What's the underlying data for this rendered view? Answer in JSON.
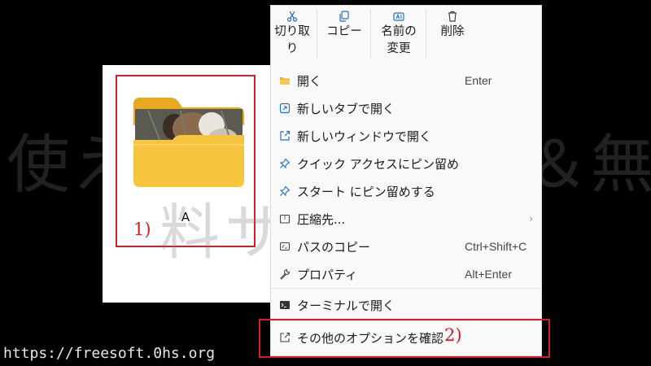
{
  "watermark": {
    "line1": "使える無料ソフト＆無",
    "line2": "料サービス"
  },
  "site_url": "https://freesoft.0hs.org",
  "explorer": {
    "folder": {
      "name": "A",
      "icon": "folder-icon-with-photo-thumbnail"
    }
  },
  "markers": {
    "one": "1)",
    "two": "2)"
  },
  "colors": {
    "highlight": "#d32027",
    "folder": "#f4c542",
    "accent": "#1f6fd1"
  },
  "context_menu": {
    "toolbar": [
      {
        "label_line1": "切り取",
        "label_line2": "り",
        "icon": "scissors-icon"
      },
      {
        "label_line1": "コピー",
        "label_line2": "",
        "icon": "copy-icon"
      },
      {
        "label_line1": "名前の",
        "label_line2": "変更",
        "icon": "rename-icon"
      },
      {
        "label_line1": "削除",
        "label_line2": "",
        "icon": "trash-icon"
      }
    ],
    "items": [
      {
        "label": "開く",
        "shortcut": "Enter",
        "icon": "folder-icon"
      },
      {
        "label": "新しいタブで開く",
        "shortcut": "",
        "icon": "new-tab-icon"
      },
      {
        "label": "新しいウィンドウで開く",
        "shortcut": "",
        "icon": "open-new-window-icon"
      },
      {
        "label": "クイック アクセスにピン留め",
        "shortcut": "",
        "icon": "pin-icon"
      },
      {
        "label": "スタート にピン留めする",
        "shortcut": "",
        "icon": "pin-icon"
      },
      {
        "label": "圧縮先...",
        "shortcut": "",
        "icon": "zip-icon",
        "submenu": "›"
      },
      {
        "label": "パスのコピー",
        "shortcut": "Ctrl+Shift+C",
        "icon": "copy-path-icon"
      },
      {
        "label": "プロパティ",
        "shortcut": "Alt+Enter",
        "icon": "wrench-icon"
      },
      {
        "label": "ターミナルで開く",
        "shortcut": "",
        "icon": "terminal-icon"
      },
      {
        "label": "その他のオプションを確認",
        "shortcut": "",
        "icon": "more-options-icon"
      }
    ]
  }
}
